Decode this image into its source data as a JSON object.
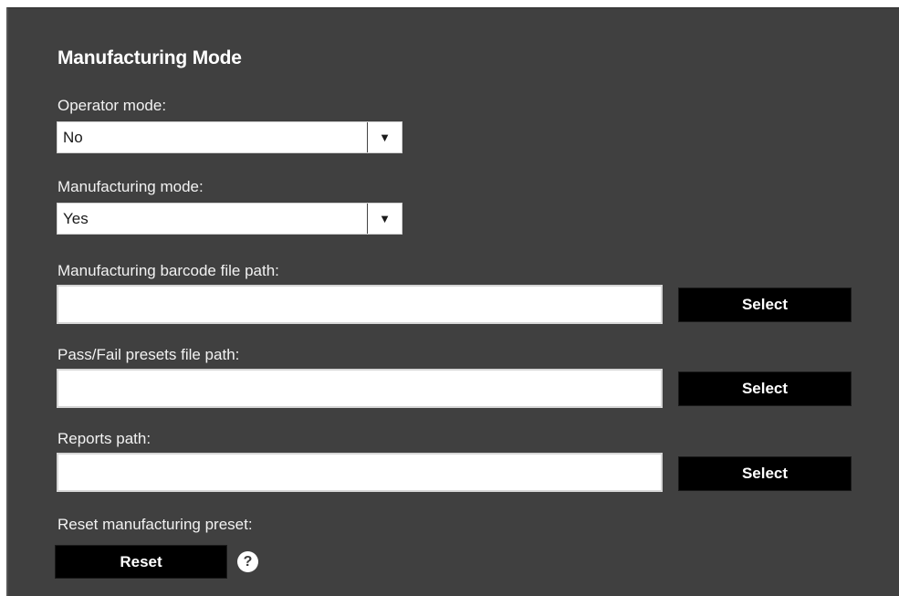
{
  "panel": {
    "title": "Manufacturing Mode",
    "operator_mode": {
      "label": "Operator mode:",
      "value": "No",
      "arrow_icon": "dropdown-arrow-icon"
    },
    "manufacturing_mode": {
      "label": "Manufacturing mode:",
      "value": "Yes",
      "arrow_icon": "dropdown-arrow-icon"
    },
    "barcode_path": {
      "label": "Manufacturing barcode file path:",
      "value": "",
      "button_label": "Select"
    },
    "passfail_path": {
      "label": "Pass/Fail presets file path:",
      "value": "",
      "button_label": "Select"
    },
    "reports_path": {
      "label": "Reports path:",
      "value": "",
      "button_label": "Select"
    },
    "reset": {
      "label": "Reset manufacturing preset:",
      "button_label": "Reset",
      "help_icon": "help-icon",
      "help_glyph": "?"
    }
  },
  "colors": {
    "panel_bg": "#404040",
    "button_bg": "#000000",
    "text": "#ffffff"
  }
}
